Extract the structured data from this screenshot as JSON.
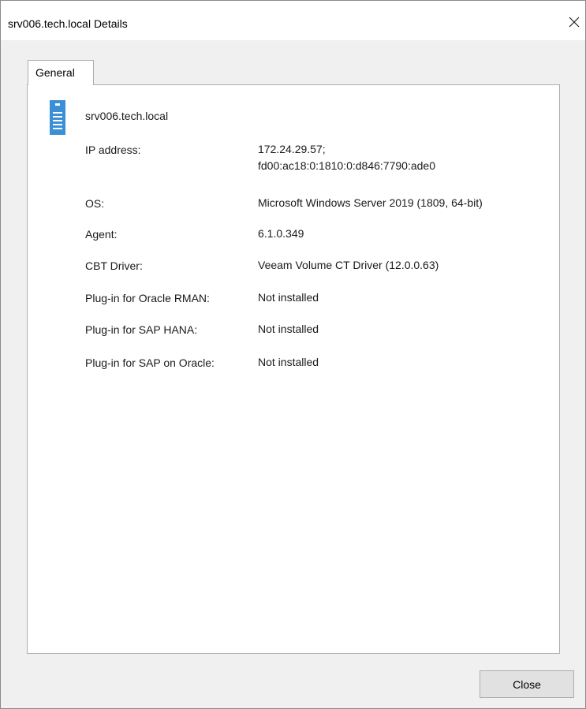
{
  "window": {
    "title": "srv006.tech.local Details",
    "close_icon": "close-icon"
  },
  "tabs": [
    {
      "label": "General",
      "selected": true
    }
  ],
  "server": {
    "icon": "server-icon",
    "icon_color": "#3a8fd6",
    "name": "srv006.tech.local"
  },
  "properties": [
    {
      "label": "IP address:",
      "value": "172.24.29.57;",
      "value2": "fd00:ac18:0:1810:0:d846:7790:ade0"
    },
    {
      "label": "OS:",
      "value": "Microsoft Windows Server 2019 (1809, 64-bit)"
    },
    {
      "label": "Agent:",
      "value": "6.1.0.349"
    },
    {
      "label": "CBT Driver:",
      "value": "Veeam Volume CT Driver (12.0.0.63)"
    },
    {
      "label": "Plug-in for Oracle RMAN:",
      "value": "Not installed"
    },
    {
      "label": "Plug-in for SAP HANA:",
      "value": "Not installed"
    },
    {
      "label": "Plug-in for SAP on Oracle:",
      "value": "Not installed"
    }
  ],
  "footer": {
    "close_label": "Close"
  }
}
